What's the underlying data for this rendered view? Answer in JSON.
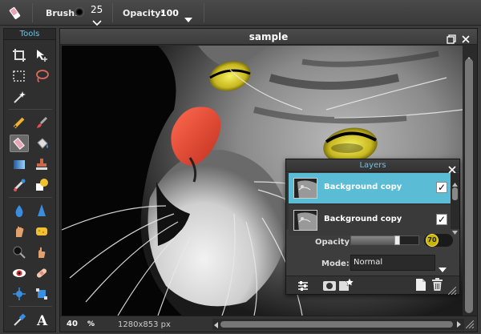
{
  "toolbar": {
    "brush_label": "Brush:",
    "brush_size": "25",
    "opacity_label": "Opacity:",
    "opacity_value": "100"
  },
  "tools": {
    "title": "Tools"
  },
  "document": {
    "title": "sample",
    "zoom": "40",
    "zoom_unit": "%",
    "dimensions": "1280x853 px"
  },
  "layers": {
    "title": "Layers",
    "items": [
      {
        "name": "Background copy",
        "visible": true,
        "selected": true
      },
      {
        "name": "Background copy",
        "visible": true,
        "selected": false
      }
    ],
    "opacity_label": "Opacity:",
    "opacity_value": "70",
    "mode_label": "Mode:",
    "mode_value": "Normal"
  },
  "colors": {
    "accent": "#5bbcd6",
    "panel_title": "#6ec3e6",
    "opacity_badge": "#c8b400"
  }
}
